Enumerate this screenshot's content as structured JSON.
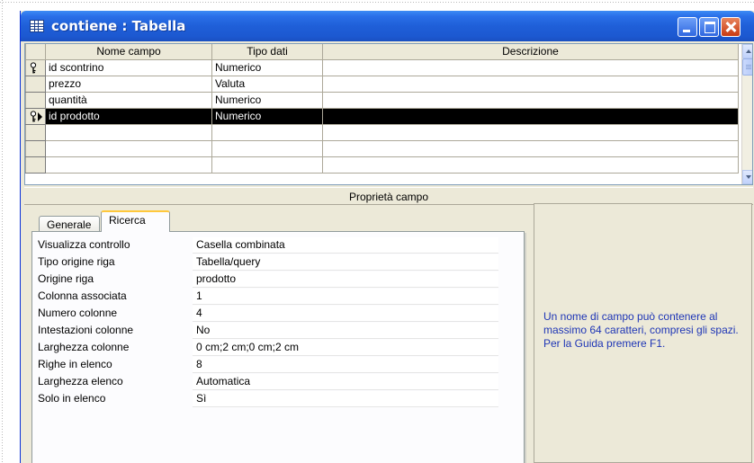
{
  "window": {
    "title": "contiene : Tabella",
    "icon": "table-icon",
    "controls": [
      "minimize-icon",
      "maximize-icon",
      "close-icon"
    ],
    "title_color": "#1f5fd8"
  },
  "grid": {
    "columns": [
      "Nome campo",
      "Tipo dati",
      "Descrizione"
    ],
    "rows": [
      {
        "name": "id scontrino",
        "type": "Numerico",
        "description": "",
        "primary_key": true
      },
      {
        "name": "prezzo",
        "type": "Valuta",
        "description": ""
      },
      {
        "name": "quantità",
        "type": "Numerico",
        "description": ""
      },
      {
        "name": "id prodotto",
        "type": "Numerico",
        "description": "",
        "primary_key": true,
        "selected": true
      }
    ],
    "empty_rows": 3
  },
  "properties": {
    "header": "Proprietà campo",
    "tabs": [
      "Generale",
      "Ricerca"
    ],
    "active_tab": "Ricerca",
    "items": [
      {
        "label": "Visualizza controllo",
        "value": "Casella combinata"
      },
      {
        "label": "Tipo origine riga",
        "value": "Tabella/query"
      },
      {
        "label": "Origine riga",
        "value": "prodotto"
      },
      {
        "label": "Colonna associata",
        "value": "1"
      },
      {
        "label": "Numero colonne",
        "value": "4"
      },
      {
        "label": "Intestazioni colonne",
        "value": "No"
      },
      {
        "label": "Larghezza colonne",
        "value": "0 cm;2 cm;0 cm;2 cm"
      },
      {
        "label": "Righe in elenco",
        "value": "8"
      },
      {
        "label": "Larghezza elenco",
        "value": "Automatica"
      },
      {
        "label": "Solo in elenco",
        "value": "Sì"
      }
    ]
  },
  "help": {
    "text": "Un nome di campo può contenere al massimo 64 caratteri, compresi gli spazi. Per la Guida premere F1.",
    "color": "#1f36b6"
  }
}
